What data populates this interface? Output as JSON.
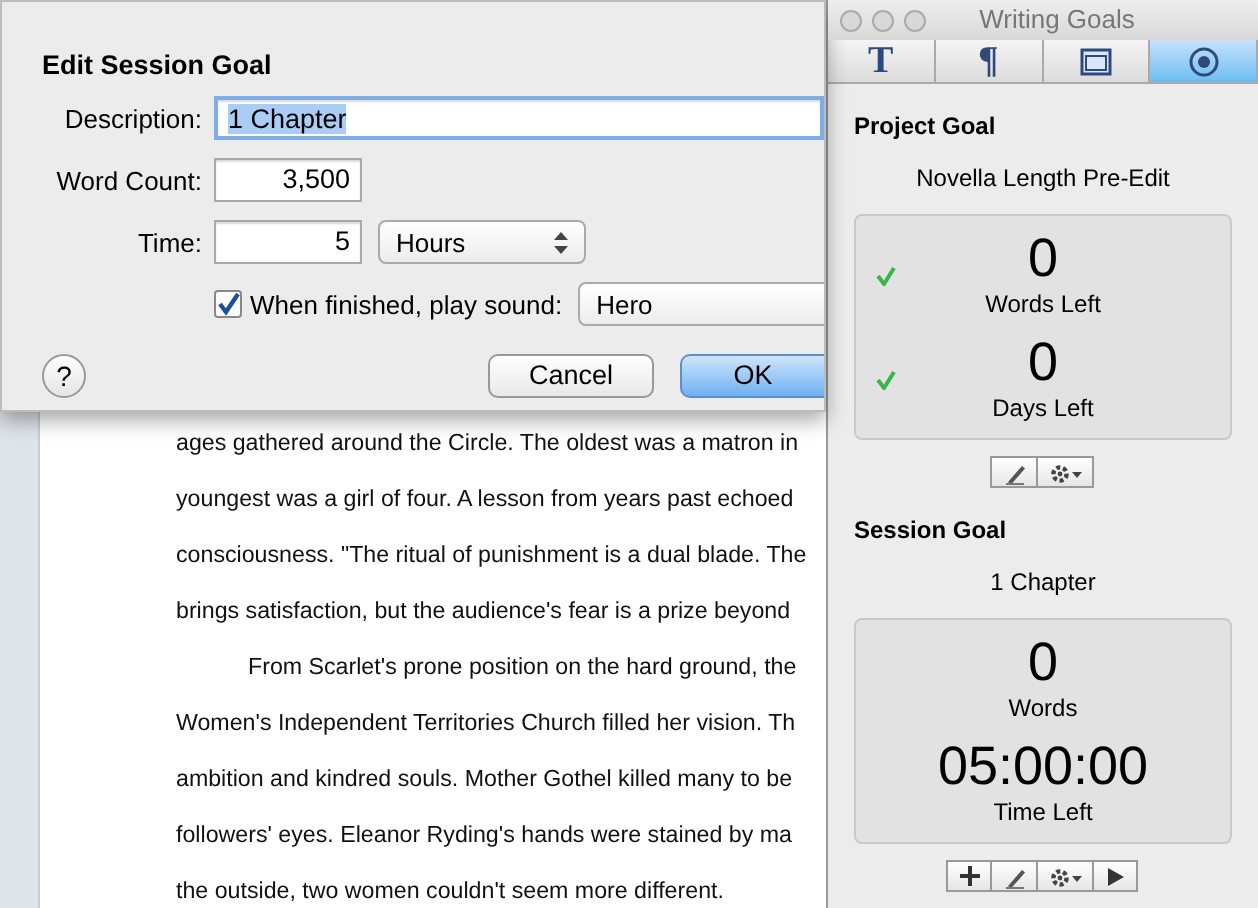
{
  "dialog": {
    "title": "Edit Session Goal",
    "description": {
      "label": "Description:",
      "value": "1 Chapter",
      "highlighted": true
    },
    "word_count": {
      "label": "Word Count:",
      "value": "3,500"
    },
    "time": {
      "label": "Time:",
      "value": "5",
      "unit": "Hours"
    },
    "sound": {
      "label": "When finished, play sound:",
      "checked": true,
      "value": "Hero"
    },
    "help": "?",
    "buttons": [
      {
        "label": "Cancel",
        "default": false
      },
      {
        "label": "OK",
        "default": true
      }
    ]
  },
  "document": {
    "lines": [
      {
        "text": "ages gathered around the Circle. The oldest was a matron in",
        "indent": false
      },
      {
        "text": "youngest was a girl of four. A lesson from years past echoed",
        "indent": false
      },
      {
        "text": "consciousness. \"The ritual of punishment is a dual blade. The",
        "indent": false
      },
      {
        "text": "brings satisfaction, but the audience's fear is a prize beyond",
        "indent": false
      },
      {
        "text": "From Scarlet's prone position on the hard ground, the",
        "indent": true
      },
      {
        "text": "Women's Independent Territories Church filled her vision. Th",
        "indent": false
      },
      {
        "text": "ambition and kindred souls. Mother Gothel killed many to be",
        "indent": false
      },
      {
        "text": "followers' eyes. Eleanor Ryding's hands were stained by ma",
        "indent": false
      },
      {
        "text": "the outside, two women couldn't seem more different.",
        "indent": false
      }
    ]
  },
  "panel": {
    "title": "Writing Goals",
    "tabs": [
      {
        "kind": "glyph",
        "glyph": "T",
        "selected": false
      },
      {
        "kind": "glyph",
        "glyph": "¶",
        "selected": false
      },
      {
        "kind": "layout",
        "selected": false
      },
      {
        "kind": "target",
        "selected": true
      }
    ],
    "project_goal": {
      "heading": "Project Goal",
      "name": "Novella Length Pre-Edit",
      "stats": [
        {
          "value": "0",
          "label": "Words Left",
          "done": true
        },
        {
          "value": "0",
          "label": "Days Left",
          "done": true
        }
      ],
      "tools": [
        {
          "kind": "edit"
        },
        {
          "kind": "gear"
        }
      ]
    },
    "session_goal": {
      "heading": "Session Goal",
      "name": "1 Chapter",
      "stats": [
        {
          "value": "0",
          "label": "Words",
          "done": false
        },
        {
          "value": "05:00:00",
          "label": "Time Left",
          "done": false
        }
      ],
      "tools": [
        {
          "kind": "add"
        },
        {
          "kind": "edit"
        },
        {
          "kind": "gear"
        },
        {
          "kind": "play"
        }
      ]
    }
  }
}
